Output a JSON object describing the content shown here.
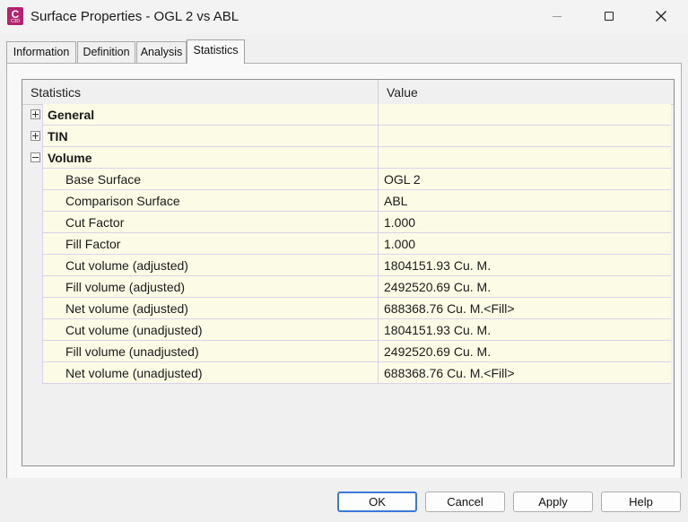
{
  "window": {
    "title": "Surface Properties - OGL 2 vs ABL",
    "app_icon_letter": "C",
    "app_icon_subtext": "C3D",
    "icons": {
      "minimize": "minimize-icon",
      "maximize": "maximize-icon",
      "close": "close-icon"
    },
    "accent_color": "#b4236f"
  },
  "tabs": [
    {
      "label": "Information",
      "active": false
    },
    {
      "label": "Definition",
      "active": false
    },
    {
      "label": "Analysis",
      "active": false
    },
    {
      "label": "Statistics",
      "active": true
    }
  ],
  "grid": {
    "headers": {
      "statistics": "Statistics",
      "value": "Value"
    },
    "groups": [
      {
        "label": "General",
        "expanded": false,
        "value": ""
      },
      {
        "label": "TIN",
        "expanded": false,
        "value": ""
      },
      {
        "label": "Volume",
        "expanded": true,
        "value": ""
      }
    ],
    "volume_rows": [
      {
        "name": "Base Surface",
        "value": "OGL 2"
      },
      {
        "name": "Comparison Surface",
        "value": "ABL"
      },
      {
        "name": "Cut Factor",
        "value": "1.000"
      },
      {
        "name": "Fill Factor",
        "value": "1.000"
      },
      {
        "name": "Cut volume (adjusted)",
        "value": "1804151.93 Cu. M."
      },
      {
        "name": "Fill volume (adjusted)",
        "value": "2492520.69 Cu. M."
      },
      {
        "name": "Net volume (adjusted)",
        "value": "688368.76 Cu. M.<Fill>"
      },
      {
        "name": "Cut volume (unadjusted)",
        "value": "1804151.93 Cu. M."
      },
      {
        "name": "Fill volume (unadjusted)",
        "value": "2492520.69 Cu. M."
      },
      {
        "name": "Net volume (unadjusted)",
        "value": "688368.76 Cu. M.<Fill>"
      }
    ]
  },
  "buttons": {
    "ok": "OK",
    "cancel": "Cancel",
    "apply": "Apply",
    "help": "Help"
  }
}
